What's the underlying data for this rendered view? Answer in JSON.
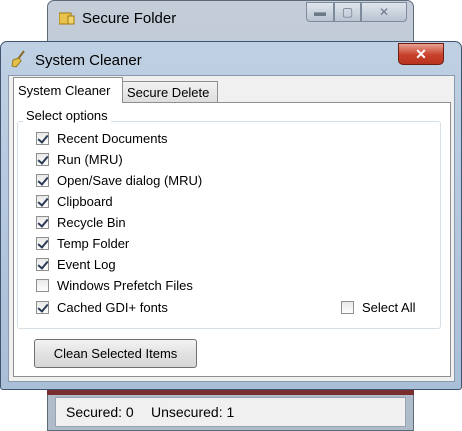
{
  "back_window": {
    "title": "Secure Folder",
    "controls": {
      "minimize": "▬",
      "maximize": "▢",
      "close": "✕"
    },
    "status": {
      "secured": "Secured: 0",
      "unsecured": "Unsecured: 1"
    }
  },
  "window": {
    "title": "System Cleaner",
    "close": "✕",
    "tabs": [
      {
        "label": "System Cleaner",
        "active": true
      },
      {
        "label": "Secure Delete",
        "active": false
      }
    ],
    "group_title": "Select options",
    "options": [
      {
        "label": "Recent Documents",
        "checked": true
      },
      {
        "label": "Run (MRU)",
        "checked": true
      },
      {
        "label": "Open/Save dialog (MRU)",
        "checked": true
      },
      {
        "label": "Clipboard",
        "checked": true
      },
      {
        "label": "Recycle Bin",
        "checked": true
      },
      {
        "label": "Temp Folder",
        "checked": true
      },
      {
        "label": "Event Log",
        "checked": true
      },
      {
        "label": "Windows Prefetch Files",
        "checked": false
      },
      {
        "label": "Cached GDI+ fonts",
        "checked": true
      }
    ],
    "select_all": {
      "label": "Select All",
      "checked": false
    },
    "clean_button": "Clean Selected Items"
  }
}
